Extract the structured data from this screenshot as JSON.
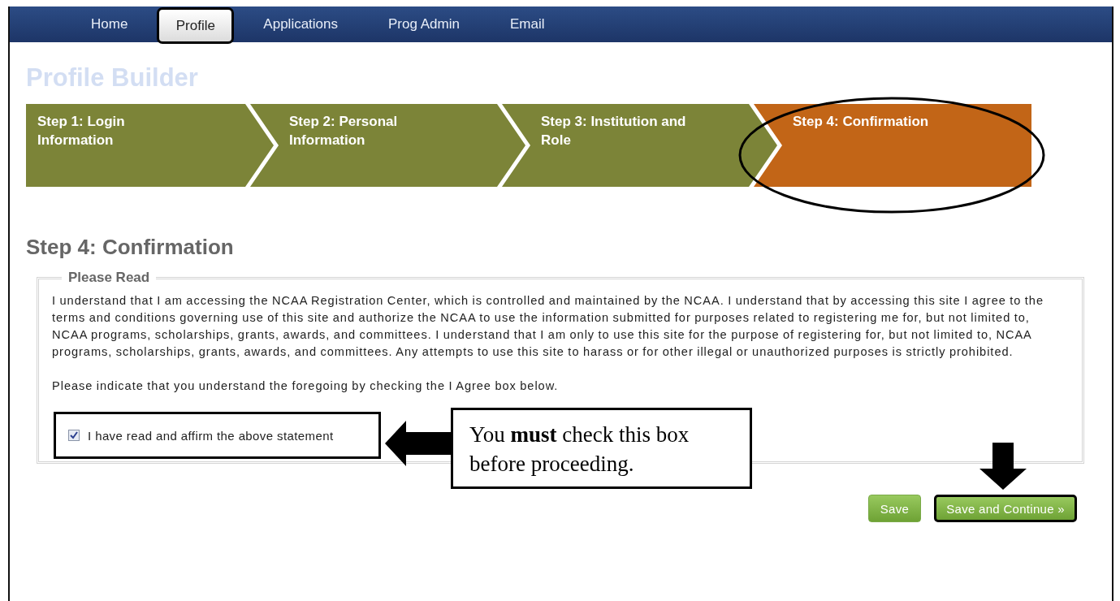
{
  "nav": {
    "items": [
      {
        "label": "Home",
        "selected": false
      },
      {
        "label": "Profile",
        "selected": true
      },
      {
        "label": "Applications",
        "selected": false
      },
      {
        "label": "Prog Admin",
        "selected": false
      },
      {
        "label": "Email",
        "selected": false
      }
    ]
  },
  "page_title": "Profile Builder",
  "steps": [
    {
      "label": "Step 1: Login Information",
      "selected": false
    },
    {
      "label": "Step 2: Personal Information",
      "selected": false
    },
    {
      "label": "Step 3: Institution and Role",
      "selected": false
    },
    {
      "label": "Step 4: Confirmation",
      "selected": true
    }
  ],
  "section_title": "Step 4: Confirmation",
  "agreement": {
    "legend": "Please Read",
    "paragraphs": [
      "I understand that I am accessing the NCAA Registration Center, which is controlled and maintained by the NCAA. I understand that by accessing this site I agree to the terms and conditions governing use of this site and authorize the NCAA to use the information submitted for purposes related to registering me for, but not limited to, NCAA programs, scholarships, grants, awards, and committees. I understand that I am only to use this site for the purpose of registering for, but not limited to, NCAA programs, scholarships, grants, awards, and committees. Any attempts to use this site to harass or for other illegal or unauthorized purposes is strictly prohibited.",
      "Please indicate that you understand the foregoing by checking the I Agree box below."
    ],
    "checkbox": {
      "label": "I have read and affirm the above statement",
      "checked": true
    }
  },
  "buttons": [
    {
      "label": "Save",
      "highlighted": false
    },
    {
      "label": "Save and Continue »",
      "highlighted": true
    }
  ],
  "callout": {
    "text": "You **must** check this box before proceeding."
  }
}
